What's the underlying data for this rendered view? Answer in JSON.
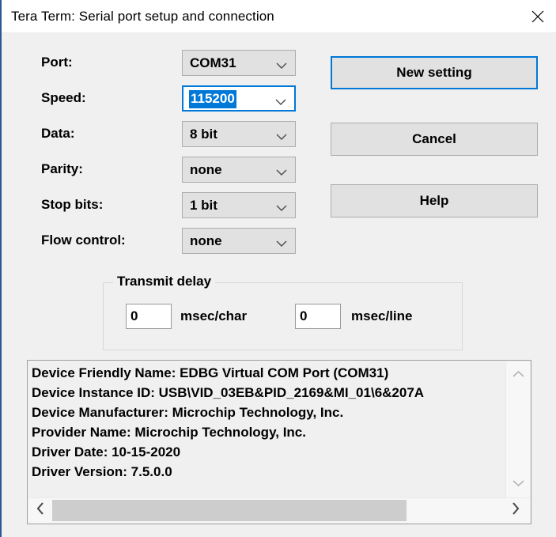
{
  "window": {
    "title": "Tera Term: Serial port setup and connection",
    "close_icon": "close-icon"
  },
  "form": {
    "fields": [
      {
        "label": "Port:",
        "value": "COM31",
        "icon": "chevron-down-icon",
        "focused": false
      },
      {
        "label": "Speed:",
        "value": "115200",
        "icon": "chevron-down-icon",
        "focused": true
      },
      {
        "label": "Data:",
        "value": "8 bit",
        "icon": "chevron-down-icon",
        "focused": false
      },
      {
        "label": "Parity:",
        "value": "none",
        "icon": "chevron-down-icon",
        "focused": false
      },
      {
        "label": "Stop bits:",
        "value": "1 bit",
        "icon": "chevron-down-icon",
        "focused": false
      },
      {
        "label": "Flow control:",
        "value": "none",
        "icon": "chevron-down-icon",
        "focused": false
      }
    ]
  },
  "buttons": {
    "new_setting": "New setting",
    "cancel": "Cancel",
    "help": "Help"
  },
  "transmit_delay": {
    "legend": "Transmit delay",
    "char_value": "0",
    "char_unit": "msec/char",
    "line_value": "0",
    "line_unit": "msec/line"
  },
  "device_info": {
    "lines": [
      "Device Friendly Name: EDBG Virtual COM Port (COM31)",
      "Device Instance ID: USB\\VID_03EB&PID_2169&MI_01\\6&207A",
      "Device Manufacturer: Microchip Technology, Inc.",
      "Provider Name: Microchip Technology, Inc.",
      "Driver Date: 10-15-2020",
      "Driver Version: 7.5.0.0"
    ],
    "scroll_up_icon": "chevron-up-icon",
    "scroll_down_icon": "chevron-down-icon",
    "scroll_left_icon": "chevron-left-icon",
    "scroll_right_icon": "chevron-right-icon"
  },
  "colors": {
    "accent": "#0078D7",
    "dialog_bg": "#F0F0F0",
    "control_bg": "#E1E1E1",
    "titlebar_bg": "#FFFFFF",
    "window_border": "#2B5797"
  }
}
